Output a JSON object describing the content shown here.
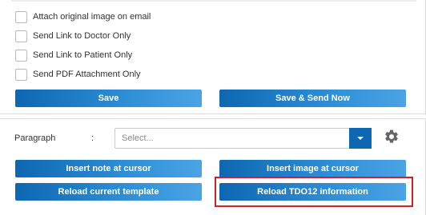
{
  "options": {
    "attach_original_image": "Attach original image on email",
    "send_link_doctor": "Send Link to Doctor Only",
    "send_link_patient": "Send Link to Patient Only",
    "send_pdf_attachment": "Send PDF Attachment Only"
  },
  "actions": {
    "save": "Save",
    "save_send_now": "Save & Send Now"
  },
  "paragraph": {
    "label": "Paragraph",
    "colon": ":",
    "placeholder": "Select..."
  },
  "template_actions": {
    "insert_note": "Insert note at cursor",
    "insert_image": "Insert image at cursor",
    "reload_template": "Reload current template",
    "reload_tdo12": "Reload TDO12 information"
  },
  "colors": {
    "button_blue": "#0d67b1",
    "highlight_red": "#d0202a"
  },
  "icons": {
    "settings": "gear-icon",
    "dropdown": "chevron-down-icon"
  }
}
